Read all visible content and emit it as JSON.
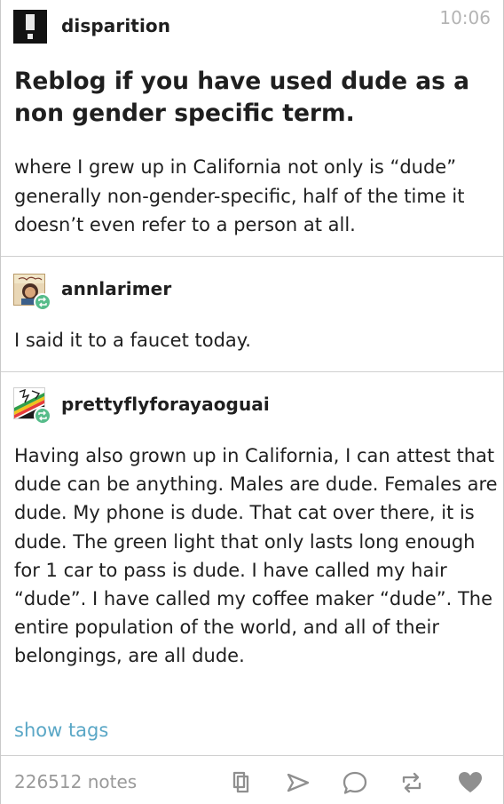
{
  "post": {
    "author": "disparition",
    "time": "10:06",
    "title": "Reblog if you have used dude as a non gender specific term.",
    "body": "where I grew up in California not only is “dude” generally non-gender-specific, half of the time it doesn’t even refer to a person at all."
  },
  "reblogs": [
    {
      "username": "annlarimer",
      "text": "I said it to a faucet today."
    },
    {
      "username": "prettyflyforayaoguai",
      "text": "Having also grown up in California, I can attest that dude can be anything. Males are dude. Females are dude. My phone is dude. That cat over there, it is dude. The green light that only lasts long enough for 1 car to pass is dude. I have called my hair “dude”. I have called my coffee maker “dude”. The entire population of the world, and all of their belongings, are all dude."
    }
  ],
  "footer": {
    "show_tags": "show tags",
    "notes": "226512  notes"
  },
  "icons": {
    "copy": "copy-icon",
    "send": "send-icon",
    "reply": "reply-icon",
    "reblog": "reblog-icon",
    "like": "heart-icon"
  },
  "colors": {
    "link": "#5aa7c6",
    "muted": "#9a9a9a",
    "reblog_badge": "#56bc8a"
  }
}
